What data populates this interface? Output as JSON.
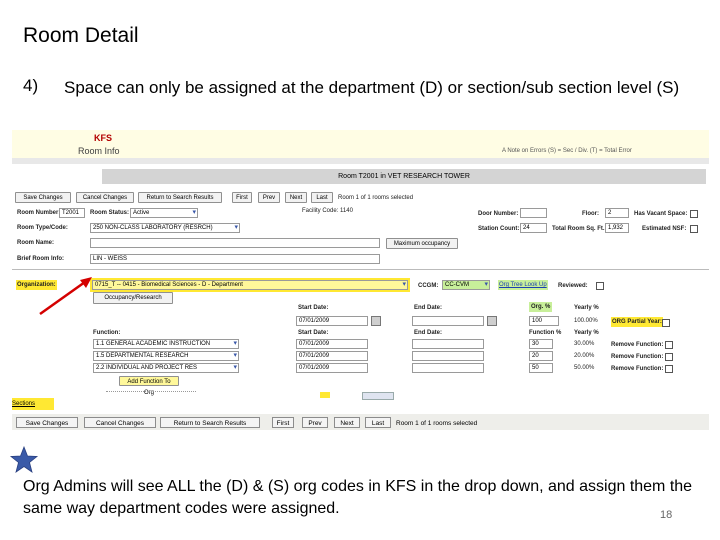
{
  "slide": {
    "title": "Room Detail",
    "point_number": "4)",
    "point_text": "Space can only be assigned at the department (D) or section/sub section level (S)",
    "footer_text": "Org Admins will see ALL the (D) & (S) org codes in KFS in the drop down, and assign them the same way department codes were assigned.",
    "page_number": "18"
  },
  "screenshot": {
    "kfs_label": "KFS",
    "page_label": "Room Info",
    "legend": "A Note on Errors (S) = Sec / Div. (T) = Total Error",
    "room_header": "Room T2001 in VET RESEARCH TOWER",
    "toolbar": {
      "save": "Save Changes",
      "cancel": "Cancel Changes",
      "return": "Return to Search Results",
      "first": "First",
      "prev": "Prev",
      "next": "Next",
      "last": "Last",
      "record_text": "Room 1 of 1 rooms selected"
    },
    "fields": {
      "room_number_label": "Room Number:",
      "room_number": "T2001",
      "room_status_label": "Room Status:",
      "room_status": "Active",
      "facility_code": "Facility Code: 1140",
      "door_number_label": "Door Number:",
      "floor_label": "Floor:",
      "floor": "2",
      "vacant_label": "Has Vacant Space:",
      "room_type_label": "Room Type/Code:",
      "room_type": "250 NON-CLASS LABORATORY (RESRCH)",
      "station_count_label": "Station Count:",
      "station_count": "24",
      "total_sqft_label": "Total Room Sq. Ft.:",
      "total_sqft": "1,932",
      "estimated_nsf_label": "Estimated NSF:",
      "room_name_label": "Room Name:",
      "max_occupancy": "Maximum occupancy",
      "brief_label": "Brief Room Info:",
      "brief_value": "LIN - WEISS",
      "organization_label": "Organization:",
      "organization": "0715_T -- 0415 - Biomedical Sciences - D - Department",
      "ccgm_label": "CCGM:",
      "ccgm_value": "CC-CVM",
      "org_tree": "Org Tree Look Up",
      "reviewed": "Reviewed:",
      "tab_label": "Occupancy/Research",
      "start_date_label": "Start Date:",
      "end_date_label": "End Date:",
      "org_pct_label": "Org. %",
      "yearly_pct_label": "Yearly %",
      "start_date_1": "07/01/2009",
      "org_pct_1": "100",
      "yearly_1": "100.00%",
      "org_partial": "ORG Partial Year:",
      "function_label": "Function:",
      "function_pct_label": "Function %",
      "yearly_pct_label2": "Yearly %",
      "functions": [
        {
          "name": "1.1 GENERAL ACADEMIC INSTRUCTION",
          "date": "07/01/2009",
          "pct": "30",
          "yearly": "30.00%",
          "remove": "Remove Function:"
        },
        {
          "name": "1.5 DEPARTMENTAL RESEARCH",
          "date": "07/01/2009",
          "pct": "20",
          "yearly": "20.00%",
          "remove": "Remove Function:"
        },
        {
          "name": "2.2 INDIVIDUAL AND PROJECT RES",
          "date": "07/01/2009",
          "pct": "50",
          "yearly": "50.00%",
          "remove": "Remove Function:"
        }
      ],
      "add_function": "Add Function To Org"
    },
    "bottom_left": "Sections",
    "bottom_toolbar": {
      "save": "Save Changes",
      "cancel": "Cancel Changes",
      "return": "Return to Search Results",
      "first": "First",
      "prev": "Prev",
      "next": "Next",
      "last": "Last",
      "record_text": "Room 1 of 1 rooms selected"
    }
  },
  "colors": {
    "highlight_yellow": "#ffe833",
    "highlight_green": "#c8ef9a",
    "arrow_red": "#d40000",
    "star_blue": "#3a5aa8"
  },
  "icons": [
    "red-arrow-icon",
    "blue-star-icon",
    "dropdown-icon",
    "calendar-icon"
  ]
}
